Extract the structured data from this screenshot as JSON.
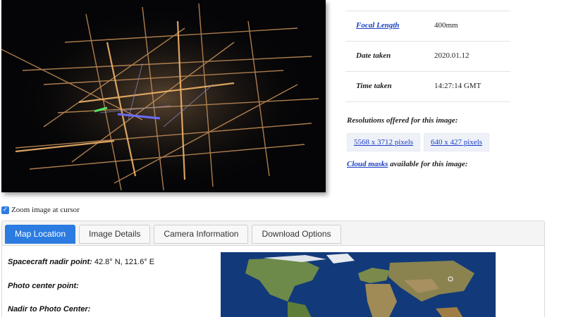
{
  "info": {
    "rows": [
      {
        "label": "Focal Length",
        "value": "400mm",
        "link": true
      },
      {
        "label": "Date taken",
        "value": "2020.01.12",
        "link": false
      },
      {
        "label": "Time taken",
        "value": "14:27:14 GMT",
        "link": false
      }
    ]
  },
  "resolutions": {
    "title": "Resolutions offered for this image:",
    "options": [
      "5568 x 3712 pixels",
      "640 x 427 pixels"
    ]
  },
  "cloud": {
    "link": "Cloud masks",
    "suffix": "available for this image:"
  },
  "zoom": {
    "label": "Zoom image at cursor",
    "checked": true
  },
  "tabs": [
    {
      "label": "Map Location",
      "active": true
    },
    {
      "label": "Image Details",
      "active": false
    },
    {
      "label": "Camera Information",
      "active": false
    },
    {
      "label": "Download Options",
      "active": false
    }
  ],
  "map_location": {
    "nadir_label": "Spacecraft nadir point:",
    "nadir_value": "42.8° N, 121.6° E",
    "center_label": "Photo center point:",
    "nadir_center_label": "Nadir to Photo Center:"
  }
}
